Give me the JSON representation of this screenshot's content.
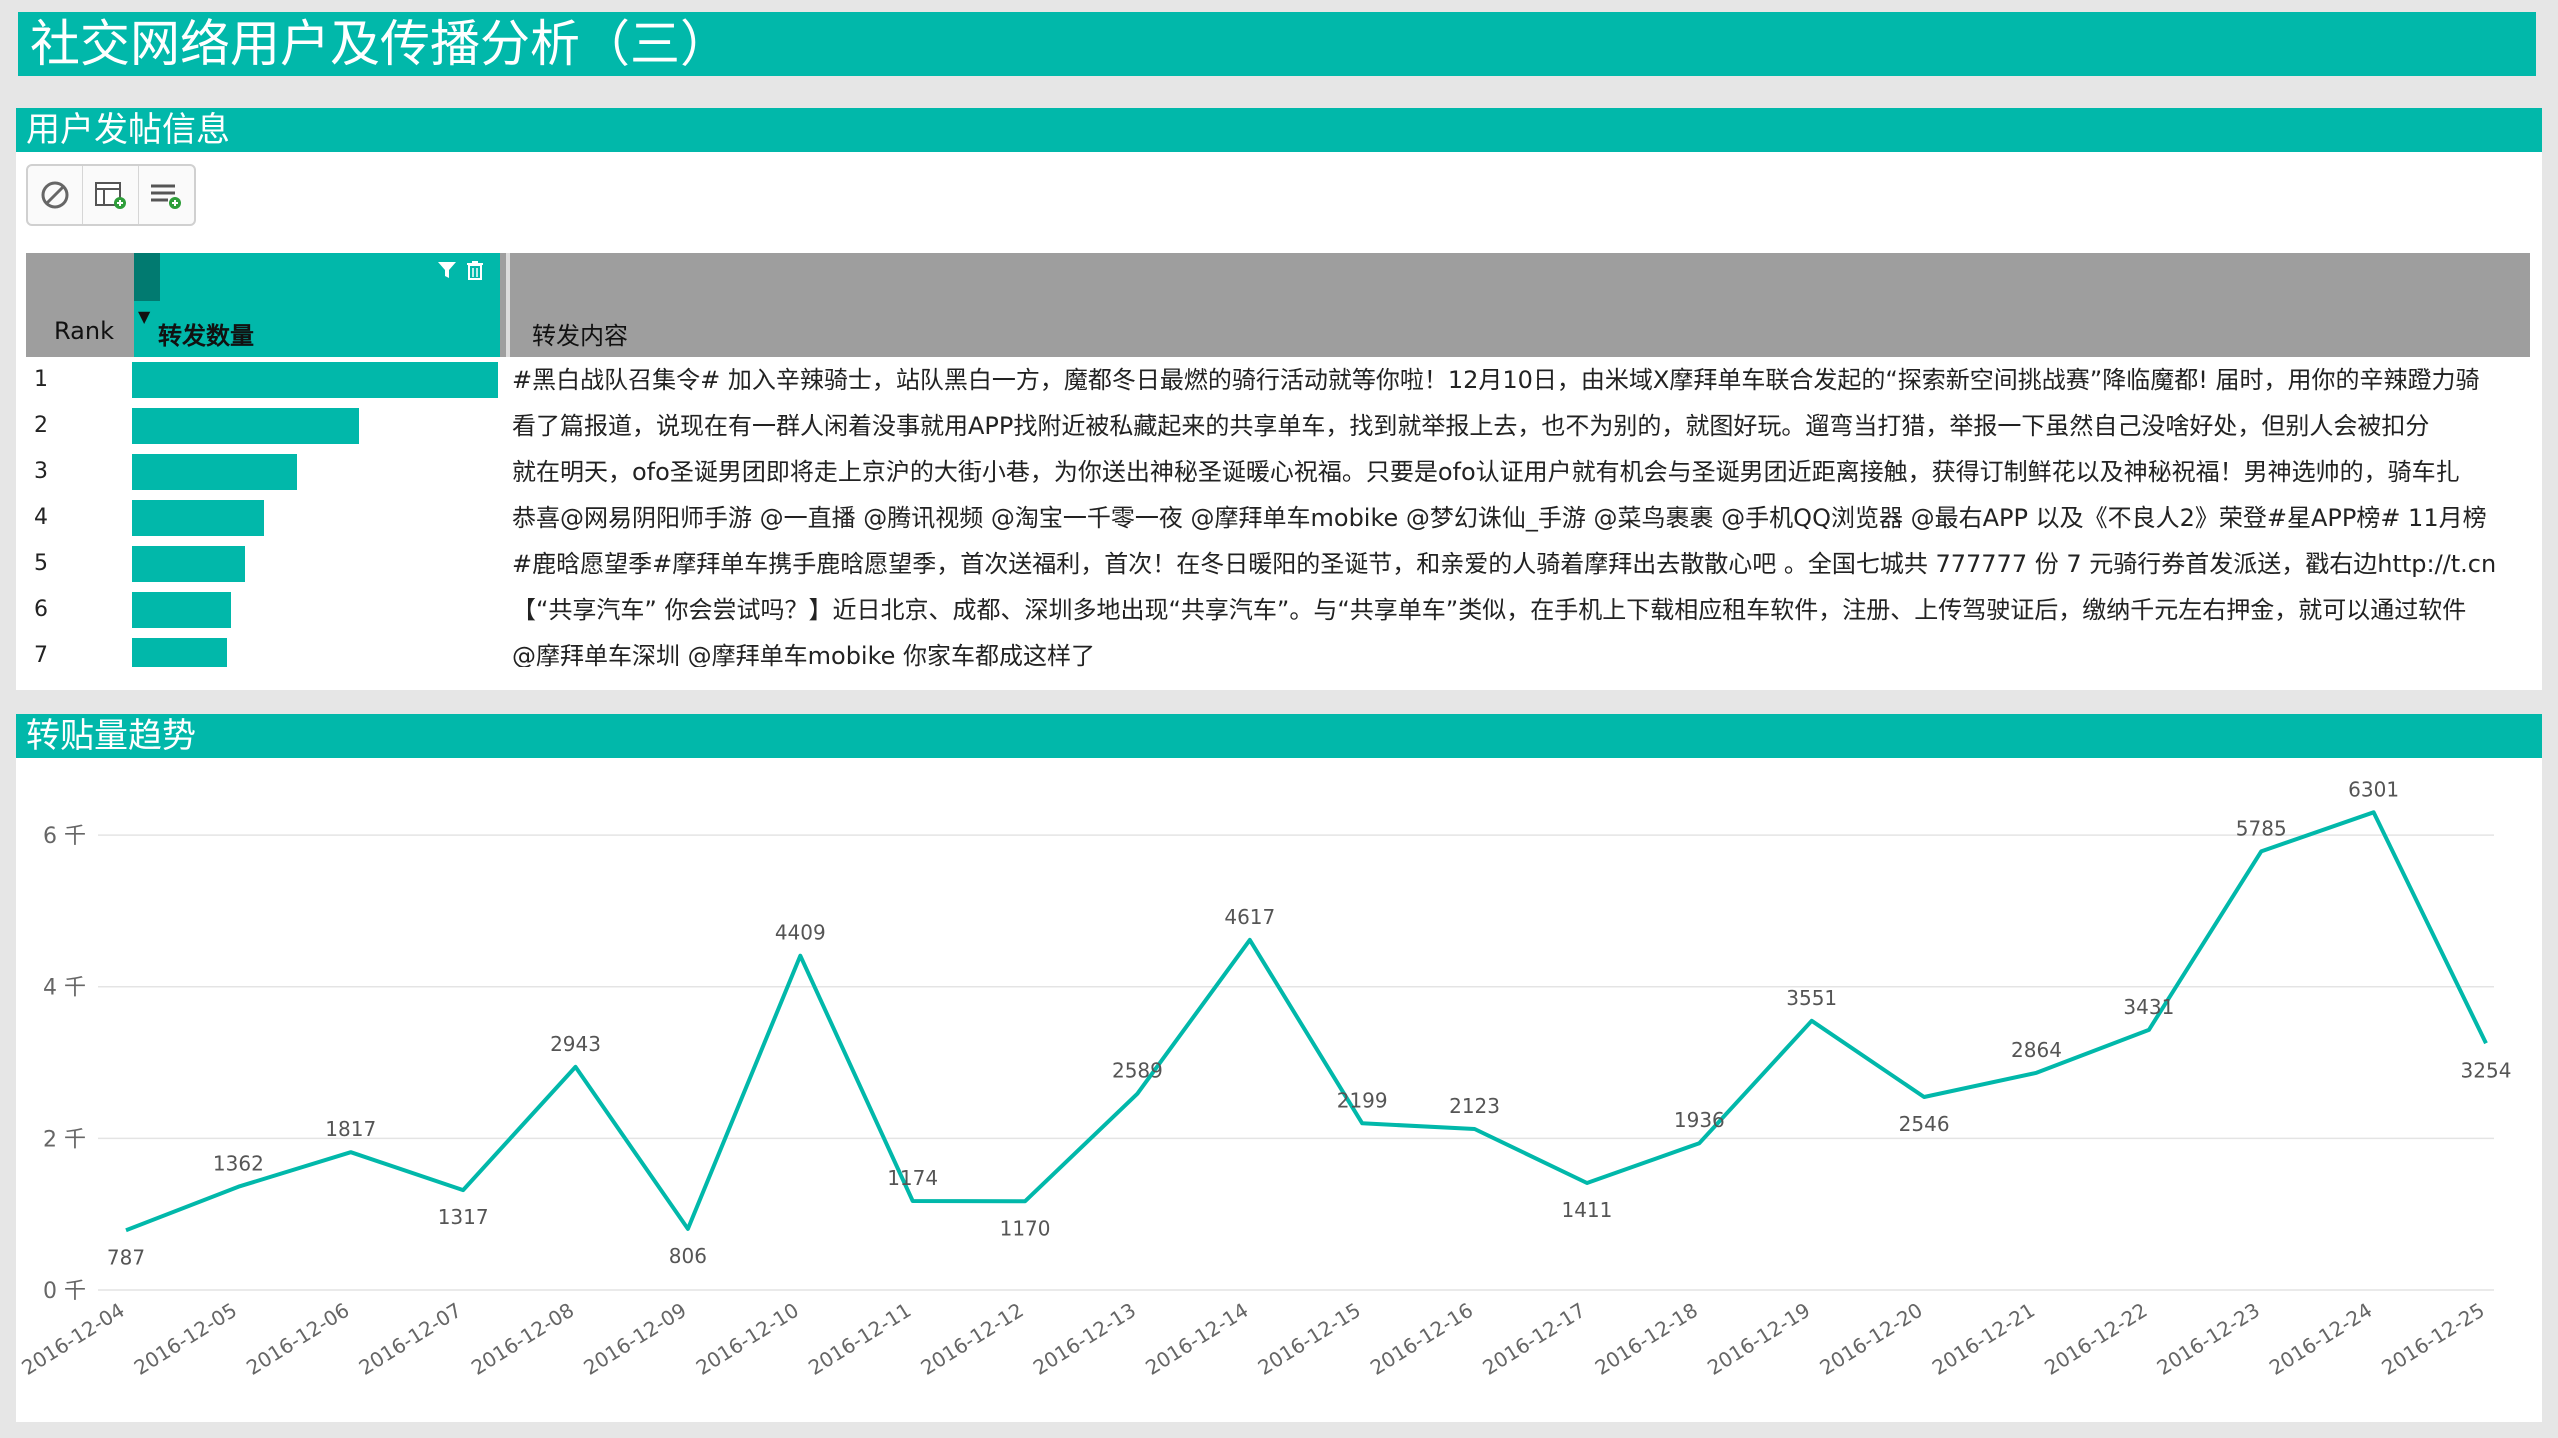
{
  "page_title": "社交网络用户及传播分析（三）",
  "posts_panel": {
    "title": "用户发帖信息",
    "toolbar": [
      {
        "icon": "clear-filter-icon"
      },
      {
        "icon": "add-table-icon"
      },
      {
        "icon": "add-rows-icon"
      }
    ],
    "columns": {
      "rank": "Rank",
      "count": "转发数量",
      "content": "转发内容"
    },
    "rows": [
      {
        "rank": "1",
        "share": 1.0,
        "text": "#黑白战队召集令# 加入辛辣骑士，站队黑白一方，魔都冬日最燃的骑行活动就等你啦！12月10日，由米域X摩拜单车联合发起的“探索新空间挑战赛”降临魔都! 届时，用你的辛辣蹬力骑"
      },
      {
        "rank": "2",
        "share": 0.62,
        "text": "看了篇报道，说现在有一群人闲着没事就用APP找附近被私藏起来的共享单车，找到就举报上去，也不为别的，就图好玩。遛弯当打猎，举报一下虽然自己没啥好处，但别人会被扣分"
      },
      {
        "rank": "3",
        "share": 0.45,
        "text": "就在明天，ofo圣诞男团即将走上京沪的大街小巷，为你送出神秘圣诞暖心祝福。只要是ofo认证用户就有机会与圣诞男团近距离接触，获得订制鲜花以及神秘祝福！男神选帅的，骑车扎"
      },
      {
        "rank": "4",
        "share": 0.36,
        "text": "恭喜@网易阴阳师手游 @一直播 @腾讯视频 @淘宝一千零一夜 @摩拜单车mobike @梦幻诛仙_手游 @菜鸟裹裹 @手机QQ浏览器 @最右APP 以及《不良人2》荣登#星APP榜# 11月榜"
      },
      {
        "rank": "5",
        "share": 0.31,
        "text": "#鹿晗愿望季#摩拜单车携手鹿晗愿望季，首次送福利，首次！在冬日暖阳的圣诞节，和亲爱的人骑着摩拜出去散散心吧 。全国七城共 777777 份 7 元骑行券首发派送，戳右边http://t.cn"
      },
      {
        "rank": "6",
        "share": 0.27,
        "text": "【“共享汽车” 你会尝试吗？】近日北京、成都、深圳多地出现“共享汽车”。与“共享单车”类似，在手机上下载相应租车软件，注册、上传驾驶证后，缴纳千元左右押金，就可以通过软件"
      },
      {
        "rank": "7",
        "share": 0.26,
        "text": "@摩拜单车深圳 @摩拜单车mobike 你家车都成这样了"
      }
    ]
  },
  "trend_panel": {
    "title": "转贴量趋势",
    "y_tick_labels": [
      "0 千",
      "2 千",
      "4 千",
      "6 千"
    ]
  },
  "chart_data": {
    "type": "line",
    "title": "",
    "xlabel": "",
    "ylabel": "",
    "x": [
      "2016-12-04",
      "2016-12-05",
      "2016-12-06",
      "2016-12-07",
      "2016-12-08",
      "2016-12-09",
      "2016-12-10",
      "2016-12-11",
      "2016-12-12",
      "2016-12-13",
      "2016-12-14",
      "2016-12-15",
      "2016-12-16",
      "2016-12-17",
      "2016-12-18",
      "2016-12-19",
      "2016-12-20",
      "2016-12-21",
      "2016-12-22",
      "2016-12-23",
      "2016-12-24",
      "2016-12-25"
    ],
    "series": [
      {
        "values": [
          787,
          1362,
          1817,
          1317,
          2943,
          806,
          4409,
          1174,
          1170,
          2589,
          4617,
          2199,
          2123,
          1411,
          1936,
          3551,
          2546,
          2864,
          3431,
          5785,
          6301,
          3254
        ]
      }
    ],
    "yticks": [
      0,
      2000,
      4000,
      6000
    ],
    "ylim": [
      0,
      6700
    ],
    "grid": true,
    "color": "#01b8aa"
  }
}
